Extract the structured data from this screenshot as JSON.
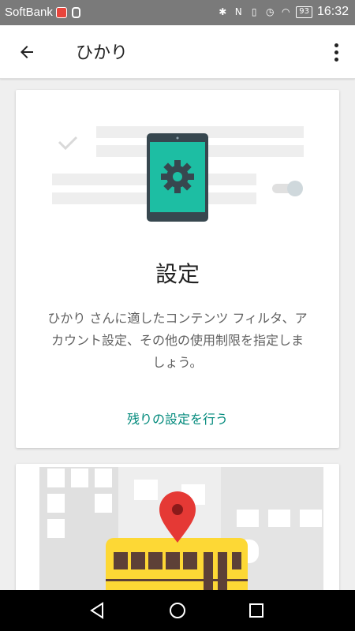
{
  "status_bar": {
    "carrier": "SoftBank",
    "battery": "93",
    "time": "16:32"
  },
  "app_bar": {
    "title": "ひかり"
  },
  "settings_card": {
    "title": "設定",
    "body": "ひかり さんに適したコンテンツ フィルタ、アカウント設定、その他の使用制限を指定しましょう。",
    "link": "残りの設定を行う"
  },
  "colors": {
    "teal_accent": "#00897b",
    "tablet_screen": "#1dbea3",
    "bus_yellow": "#fdd835",
    "pin_red": "#e53935"
  }
}
